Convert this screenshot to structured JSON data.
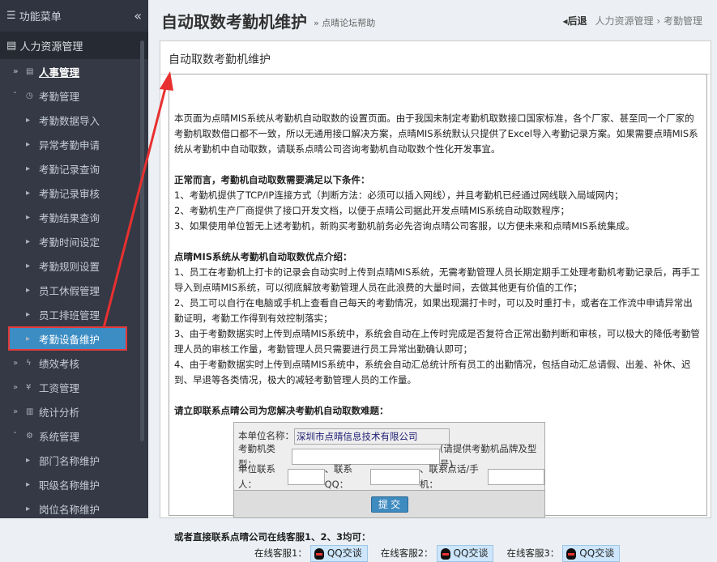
{
  "sidebar": {
    "title": "功能菜单",
    "collapse": "«",
    "section": "人力资源管理",
    "items": [
      "人事管理",
      "考勤管理",
      "考勤数据导入",
      "异常考勤申请",
      "考勤记录查询",
      "考勤记录审核",
      "考勤结果查询",
      "考勤时间设定",
      "考勤规则设置",
      "员工休假管理",
      "员工排班管理",
      "考勤设备维护",
      "绩效考核",
      "工资管理",
      "统计分析",
      "系统管理",
      "部门名称维护",
      "职级名称维护",
      "岗位名称维护"
    ]
  },
  "header": {
    "title": "自动取数考勤机维护",
    "help": "» 点晴论坛帮助",
    "back": "◂后退",
    "crumbs": [
      "人力资源管理",
      "›",
      "考勤管理"
    ]
  },
  "panel": {
    "title": "自动取数考勤机维护",
    "intro": "本页面为点晴MIS系统从考勤机自动取数的设置页面。由于我国未制定考勤机取数接口国家标准，各个厂家、甚至同一个厂家的考勤机取数借口都不一致，所以无通用接口解决方案，点晴MIS系统默认只提供了Excel导入考勤记录方案。如果需要点晴MIS系统从考勤机中自动取数，请联系点晴公司咨询考勤机自动取数个性化开发事宜。",
    "cond_title": "正常而言，考勤机自动取数需要满足以下条件：",
    "conds": [
      "1、考勤机提供了TCP/IP连接方式（判断方法：必须可以插入网线），并且考勤机已经通过网线联入局域网内；",
      "2、考勤机生产厂商提供了接口开发文档，以便于点晴公司据此开发点晴MIS系统自动取数程序；",
      "3、如果使用单位暂无上述考勤机，新购买考勤机前务必先咨询点晴公司客服，以方便未来和点晴MIS系统集成。"
    ],
    "adv_title": "点晴MIS系统从考勤机自动取数优点介绍：",
    "advs": [
      "1、员工在考勤机上打卡的记录会自动实时上传到点晴MIS系统，无需考勤管理人员长期定期手工处理考勤机考勤记录后，再手工导入到点晴MIS系统，可以彻底解放考勤管理人员在此浪费的大量时间，去做其他更有价值的工作；",
      "2、员工可以自行在电脑或手机上查看自己每天的考勤情况，如果出现漏打卡时，可以及时重打卡，或者在工作流中申请异常出勤证明，考勤工作得到有效控制落实；",
      "3、由于考勤数据实时上传到点晴MIS系统中，系统会自动在上传时完成是否复符合正常出勤判断和审核，可以极大的降低考勤管理人员的审核工作量，考勤管理人员只需要进行员工异常出勤确认即可；",
      "4、由于考勤数据实时上传到点晴MIS系统中，系统会自动汇总统计所有员工的出勤情况，包括自动汇总请假、出差、补休、迟到、早退等各类情况，极大的减轻考勤管理人员的工作量。"
    ],
    "contact_title": "请立即联系点晴公司为您解决考勤机自动取数难题：",
    "form": {
      "company_label": "本单位名称：",
      "company_value": "深圳市点晴信息技术有限公司",
      "type_label": "考勤机类型：",
      "type_hint": "(请提供考勤机品牌及型号)",
      "person_label": "单位联系人：",
      "qq_label": "、联系QQ：",
      "phone_label": "、联系点话/手机：",
      "submit": "提 交"
    },
    "online_title": "或者直接联系点晴公司在线客服1、2、3均可：",
    "services": [
      {
        "label": "在线客服1：",
        "btn": "QQ交谈"
      },
      {
        "label": "在线客服2：",
        "btn": "QQ交谈"
      },
      {
        "label": "在线客服3：",
        "btn": "QQ交谈"
      }
    ]
  }
}
